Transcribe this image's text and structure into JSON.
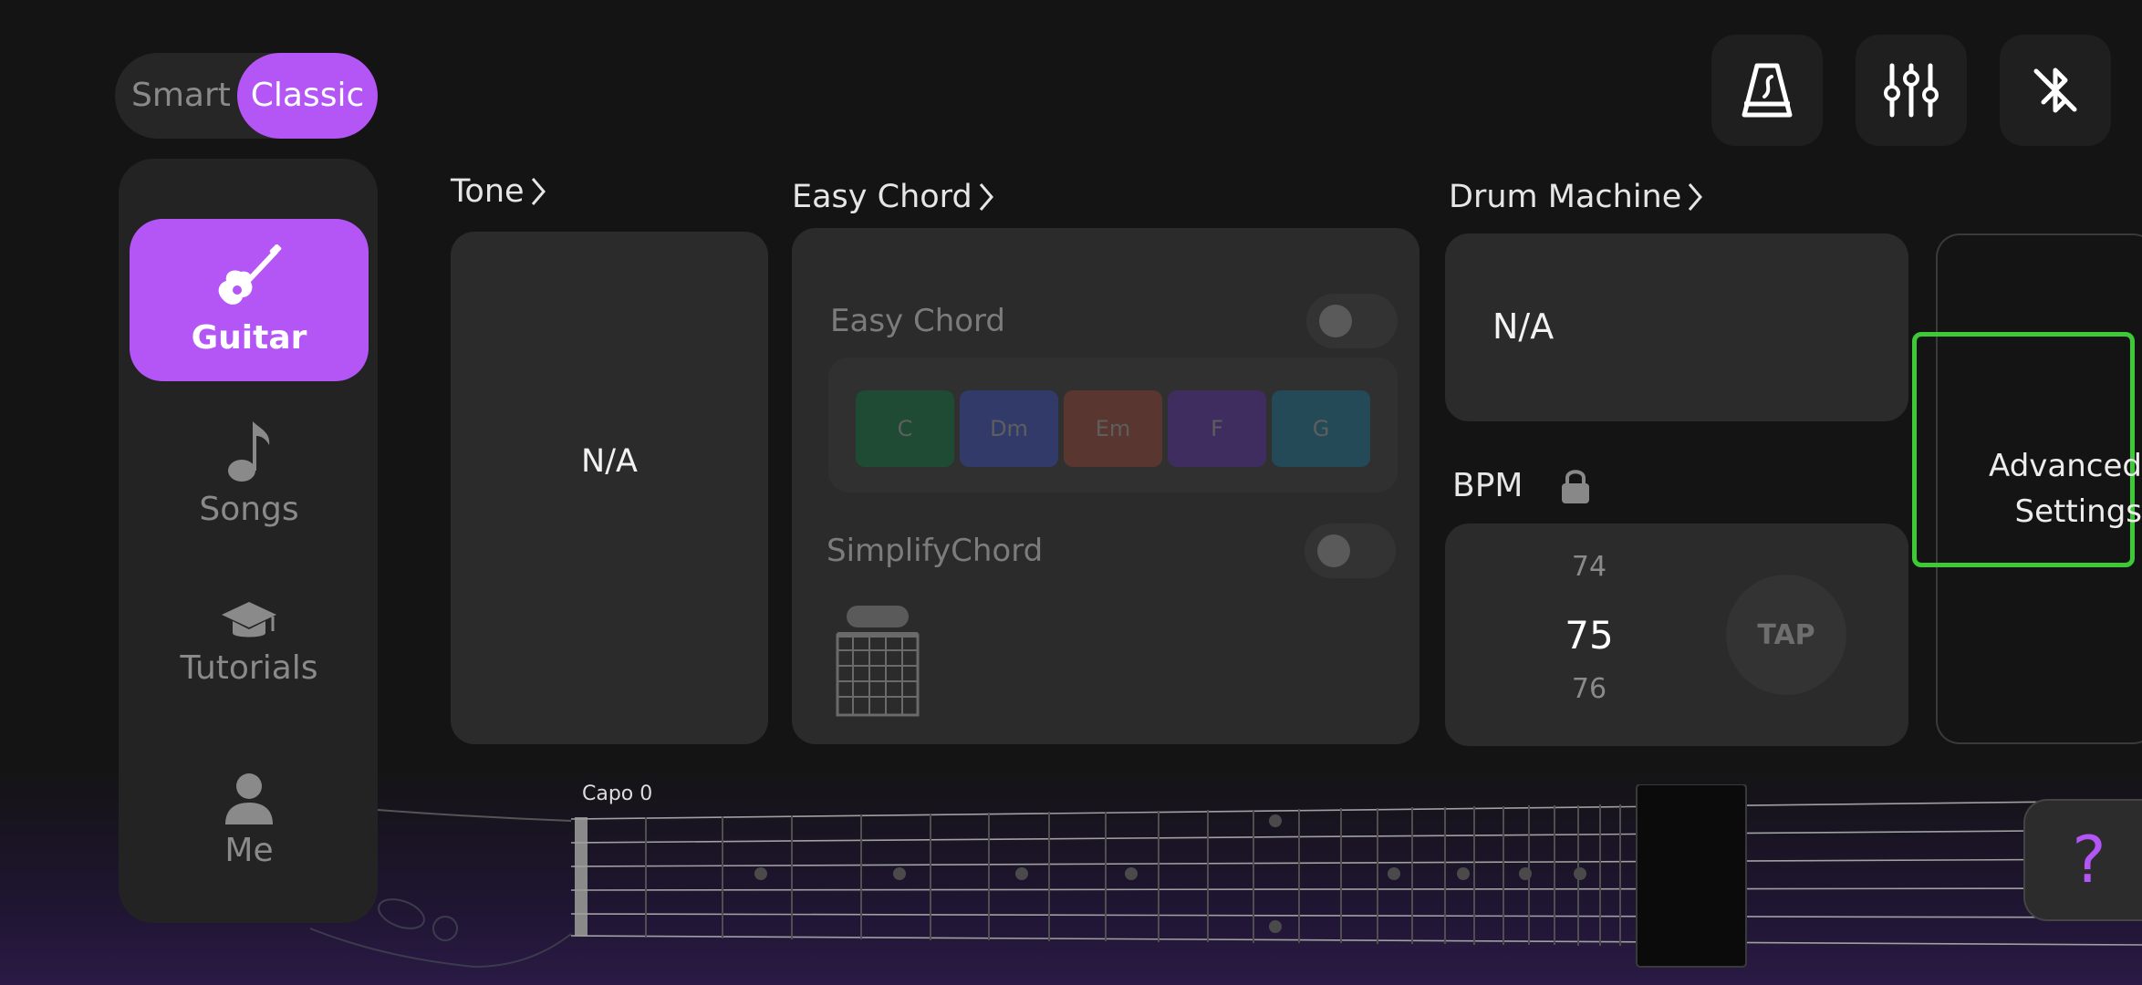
{
  "mode": {
    "smart": "Smart",
    "classic": "Classic",
    "selected": "Classic"
  },
  "topbar": {
    "icons": [
      "metronome-icon",
      "mixer-icon",
      "bluetooth-off-icon"
    ]
  },
  "sidebar": {
    "items": [
      {
        "label": "Guitar",
        "icon": "guitar-icon",
        "active": true
      },
      {
        "label": "Songs",
        "icon": "music-note-icon",
        "active": false
      },
      {
        "label": "Tutorials",
        "icon": "graduation-cap-icon",
        "active": false
      },
      {
        "label": "Me",
        "icon": "user-icon",
        "active": false
      }
    ]
  },
  "tone": {
    "title": "Tone",
    "value": "N/A"
  },
  "easy_chord": {
    "title": "Easy Chord",
    "toggle_label": "Easy Chord",
    "enabled": false,
    "chords": [
      {
        "name": "C",
        "color": "#1f4a34"
      },
      {
        "name": "Dm",
        "color": "#323a6a"
      },
      {
        "name": "Em",
        "color": "#5a3630"
      },
      {
        "name": "F",
        "color": "#3e2d5e"
      },
      {
        "name": "G",
        "color": "#244a58"
      }
    ],
    "simplify_label": "SimplifyChord",
    "simplify_enabled": false
  },
  "drum": {
    "title": "Drum Machine",
    "value": "N/A"
  },
  "bpm": {
    "label": "BPM",
    "prev": "74",
    "current": "75",
    "next": "76",
    "tap": "TAP"
  },
  "advanced": {
    "line1": "Advanced",
    "line2": "Settings"
  },
  "fretboard": {
    "capo": "Capo 0"
  },
  "help": {
    "label": "?"
  },
  "colors": {
    "accent": "#b455f5",
    "highlight": "#3ec936"
  }
}
